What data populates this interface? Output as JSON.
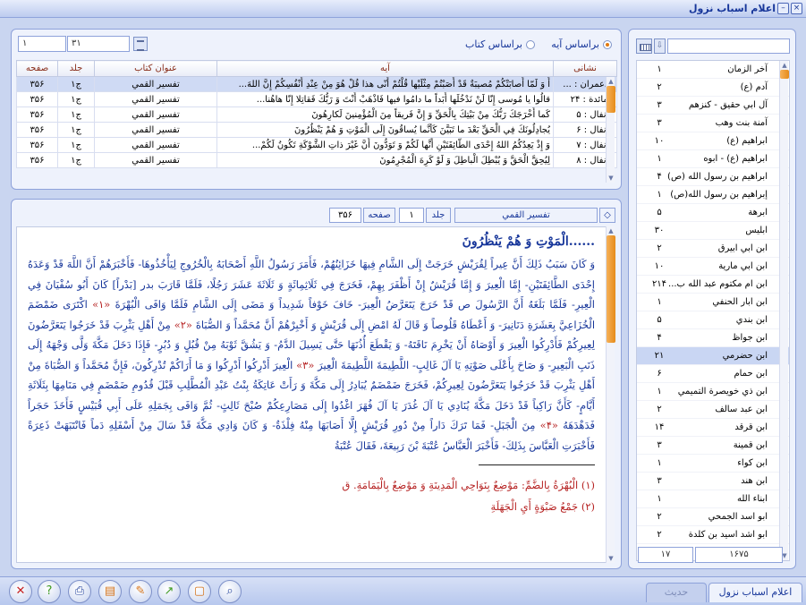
{
  "window": {
    "title": "اعلام اسباب نزول",
    "minimize": "–",
    "close": "×"
  },
  "search_mode": {
    "by_aya": "براساس آیه",
    "by_book": "براساس کتاب",
    "selected": "by_aya"
  },
  "grid_nav": {
    "current": "۳۱",
    "total": "۱"
  },
  "grid": {
    "headers": {
      "nesh": "نشانی",
      "aya": "آیه",
      "book": "عنوان کتاب",
      "jild": "جلد",
      "page": "صفحه"
    },
    "rows": [
      {
        "nesh": "آل‌عمران : ...",
        "aya": "أَ وَ لَمّا أَصابَتْكُمْ مُصيبَةٌ قَدْ أَصَبْتُمْ مِثْلَيْها قُلْتُمْ أَنّى هذا قُلْ هُوَ مِنْ عِنْدِ أَنْفُسِكُمْ إِنَّ اللهَ...",
        "book": "تفسير القمي",
        "jild": "ج۱",
        "page": "۳۵۶"
      },
      {
        "nesh": "المائدة : ۲۴",
        "aya": "قالُوا يا مُوسى إِنّا لَنْ نَدْخُلَها أَبَداً ما دامُوا فيها فَاذْهَبْ أَنْتَ وَ رَبُّكَ فَقاتِلا إِنّا هاهُنا...",
        "book": "تفسير القمي",
        "jild": "ج۱",
        "page": "۳۵۶"
      },
      {
        "nesh": "الأنفال : ۵",
        "aya": "كَما أَخْرَجَكَ رَبُّكَ مِنْ بَيْتِكَ بِالْحَقِّ وَ إِنَّ فَريقاً مِنَ الْمُؤْمِنينَ لَكارِهُونَ",
        "book": "تفسير القمي",
        "jild": "ج۱",
        "page": "۳۵۶"
      },
      {
        "nesh": "الأنفال : ۶",
        "aya": "يُجادِلُونَكَ فِي الْحَقِّ بَعْدَ ما تَبَيَّنَ كَأَنَّما يُساقُونَ إِلَى الْمَوْتِ وَ هُمْ يَنْظُرُونَ",
        "book": "تفسير القمي",
        "jild": "ج۱",
        "page": "۳۵۶"
      },
      {
        "nesh": "الأنفال : ۷",
        "aya": "وَ إِذْ يَعِدُكُمُ اللهُ إِحْدَى الطّائِفَتَيْنِ أَنَّها لَكُمْ وَ تَوَدُّونَ أَنَّ غَيْرَ ذاتِ الشَّوْكَةِ تَكُونُ لَكُمْ...",
        "book": "تفسير القمي",
        "jild": "ج۱",
        "page": "۳۵۶"
      },
      {
        "nesh": "الأنفال : ۸",
        "aya": "لِيُحِقَّ الْحَقَّ وَ يُبْطِلَ الْباطِلَ وَ لَوْ كَرِهَ الْمُجْرِمُونَ",
        "book": "تفسير القمي",
        "jild": "ج۱",
        "page": "۳۵۶"
      }
    ]
  },
  "text_header": {
    "book": "تفسير القمي",
    "jild_label": "جلد",
    "jild": "۱",
    "page_label": "صفحه",
    "page": "۳۵۶"
  },
  "text": {
    "heading": "......الْمَوْتِ وَ هُمْ يَنْظُرُونَ",
    "p1": "وَ كَانَ سَبَبُ ذَلِكَ أَنَّ عِيراً لِقُرَيْشٍ خَرَجَتْ إِلَى الشَّامِ فِيهَا خَزَائِنُهُمْ، فَأَمَرَ رَسُولُ اللَّهِ أَصْحَابَهُ بِالْخُرُوجِ لِيَأْخُذُوهَا- فَأَخْبَرَهُمْ أَنَّ اللَّهَ قَدْ وَعَدَهُ إِحْدَى الطَّائِفَتَيْنِ- إِمَّا الْعِيرَ وَ إِمَّا قُرَيْشٌ إِنْ أَظْفَرَ بِهِمْ، فَخَرَجَ فِي ثَلَاثِمِائَةٍ وَ ثَلَاثَةَ عَشَرَ رَجُلًا، فَلَمَّا قَارَبَ بدر [بَدْراً] كَانَ أَبُو سُفْيَانَ فِي الْعِيرِ- فَلَمَّا بَلَغَهُ أَنَّ الرَّسُولَ ص قَدْ خَرَجَ يَتَعَرَّضُ الْعِيرَ- خَافَ خَوْفاً شَدِيداً وَ مَضَى إِلَى الشَّامِ فَلَمَّا وَافَى الْبُهْرَةَ",
    "r1": "«۱»",
    "p2": "اكْتَرَى ضَمْضَمَ الْخُزَاعِيَّ بِعَشَرَةِ دَنَانِيرَ- وَ أَعْطَاهُ قَلُوصاً وَ قَالَ لَهُ امْضِ إِلَى قُرَيْشٍ وَ أَخْبِرْهُمْ أَنَّ مُحَمَّداً وَ الصُّبَاةَ",
    "r2": "«۲»",
    "p3": "مِنْ أَهْلِ يَثْرِبَ قَدْ خَرَجُوا يَتَعَرَّضُونَ لِعِيرِكُمْ فَأَدْرِكُوا الْعِيرَ وَ أَوْصَاهُ أَنْ يَخْرِمَ نَاقَتَهُ- وَ يَقْطَعَ أُذُنَهَا حَتَّى يَسِيلَ الدَّمُ- وَ يَشُقَّ ثَوْبَهُ مِنْ قُبُلٍ وَ دُبُرٍ- فَإِذَا دَخَلَ مَكَّةَ وَلَّى وَجْهَهُ إِلَى ذَنَبِ الْبَعِيرِ- وَ صَاحَ بِأَعْلَى صَوْتِهِ يَا آلَ غَالِبٍ- اللَّطِيمَةَ اللَّطِيمَةَ الْعِيرَ",
    "r3": "«۳»",
    "p4": "الْعِيرَ أَدْرِكُوا أَدْرِكُوا وَ مَا أَرَاكُمْ تُدْرِكُونَ، فَإِنَّ مُحَمَّداً وَ الصُّبَاةَ مِنْ أَهْلِ يَثْرِبَ قَدْ خَرَجُوا يَتَعَرَّضُونَ لِعِيرِكُمْ، فَخَرَجَ ضَمْضَمٌ يُبَادِرُ إِلَى مَكَّةَ وَ رَأَتْ عَاتِكَةُ بِنْتُ عَبْدِ الْمُطَّلِبِ قَبْلَ قُدُومِ ضَمْضَمٍ فِي مَنَامِهَا بِثَلَاثَةِ أَيَّامٍ- كَأَنَّ رَاكِباً قَدْ دَخَلَ مَكَّةَ يُنَادِي يَا آلَ غُدَرَ يَا آلَ فُهَرَ اغْدُوا إِلَى مَصَارِعِكُمْ صُبْحَ ثَالِثٍ- ثُمَّ وَافَى بِجَمَلِهِ عَلَى أَبِي قُبَيْسٍ فَأَخَذَ حَجَراً فَدَهْدَهَهُ",
    "r4": "«۴»",
    "p5": "مِنَ الْجَبَلِ- فَمَا تَرَكَ دَاراً مِنْ دُورِ قُرَيْشٍ إِلَّا أَصَابَهَا مِنْهُ فِلْذَةٌ- وَ كَانَ وَادِي مَكَّةَ قَدْ سَالَ مِنْ أَسْفَلِهِ دَماً فَانْتَبَهَتْ ذَعِرَةً فَأَخْبَرَتِ الْعَبَّاسَ بِذَلِكَ- فَأَخْبَرَ الْعَبَّاسُ عُتْبَةَ بْنَ رَبِيعَةَ، فَقَالَ عُتْبَةُ",
    "fn1": "(۱) الْبُهْرَةُ بِالضَّمِّ: مَوْضِعٌ بِنَوَاحِي الْمَدِينَةِ وَ مَوْضِعٌ بِالْيَمَامَةِ. ق",
    "fn2": "(۲) جَمْعُ صَبْوَةٍ أَيِ الْجَهَلَةِ"
  },
  "list": {
    "search_value": "",
    "items": [
      {
        "name": "آخر الزمان",
        "count": "۱"
      },
      {
        "name": "آدم (ع)",
        "count": "۲"
      },
      {
        "name": "آل ابي حقيق - كنزهم",
        "count": "۳"
      },
      {
        "name": "آمنة بنت وهب",
        "count": "۳"
      },
      {
        "name": "ابراهيم (ع)",
        "count": "۱۰"
      },
      {
        "name": "ابراهيم (ع) - ابوه",
        "count": "۱"
      },
      {
        "name": "ابراهيم بن رسول الله (ص)",
        "count": "۴"
      },
      {
        "name": "إبراهيم بن رسول الله(ص)",
        "count": "۱"
      },
      {
        "name": "ابرهة",
        "count": "۵"
      },
      {
        "name": "ابليس",
        "count": "۳۰"
      },
      {
        "name": "ابن ابي ابيرق",
        "count": "۲"
      },
      {
        "name": "ابن ابي مارية",
        "count": "۱۰"
      },
      {
        "name": "ابن ام مكتوم عبد الله ب...",
        "count": "۲۱۴"
      },
      {
        "name": "ابن ابار الحنفي",
        "count": "۱"
      },
      {
        "name": "ابن بندي",
        "count": "۵"
      },
      {
        "name": "ابن جواظ",
        "count": "۴"
      },
      {
        "name": "ابن حضرمي",
        "count": "۲۱"
      },
      {
        "name": "ابن حمام",
        "count": "۶"
      },
      {
        "name": "ابن ذي خويصرة التميمي",
        "count": "۱"
      },
      {
        "name": "ابن عبد سالف",
        "count": "۲"
      },
      {
        "name": "ابن قرقد",
        "count": "۱۴"
      },
      {
        "name": "ابن قمينة",
        "count": "۳"
      },
      {
        "name": "ابن كواء",
        "count": "۱"
      },
      {
        "name": "ابن هند",
        "count": "۳"
      },
      {
        "name": "ابناء الله",
        "count": "۱"
      },
      {
        "name": "ابو اسد الجمحي",
        "count": "۲"
      },
      {
        "name": "ابو اشد اسيد بن كلدة",
        "count": "۲"
      }
    ],
    "footer_total": "۱۶۷۵",
    "footer_current": "۱۷"
  },
  "bottom": {
    "buttons": [
      {
        "name": "close-app-icon",
        "glyph": "✕"
      },
      {
        "name": "help-icon",
        "glyph": "?"
      },
      {
        "name": "print-icon",
        "glyph": "⎙"
      },
      {
        "name": "book-icon",
        "glyph": "▤"
      },
      {
        "name": "edit-icon",
        "glyph": "✎"
      },
      {
        "name": "export-icon",
        "glyph": "↗"
      },
      {
        "name": "page-icon",
        "glyph": "▢"
      },
      {
        "name": "search-icon",
        "glyph": "⌕"
      }
    ],
    "tab_active": "اعلام اسباب نزول",
    "tab_inactive": "حديث"
  }
}
